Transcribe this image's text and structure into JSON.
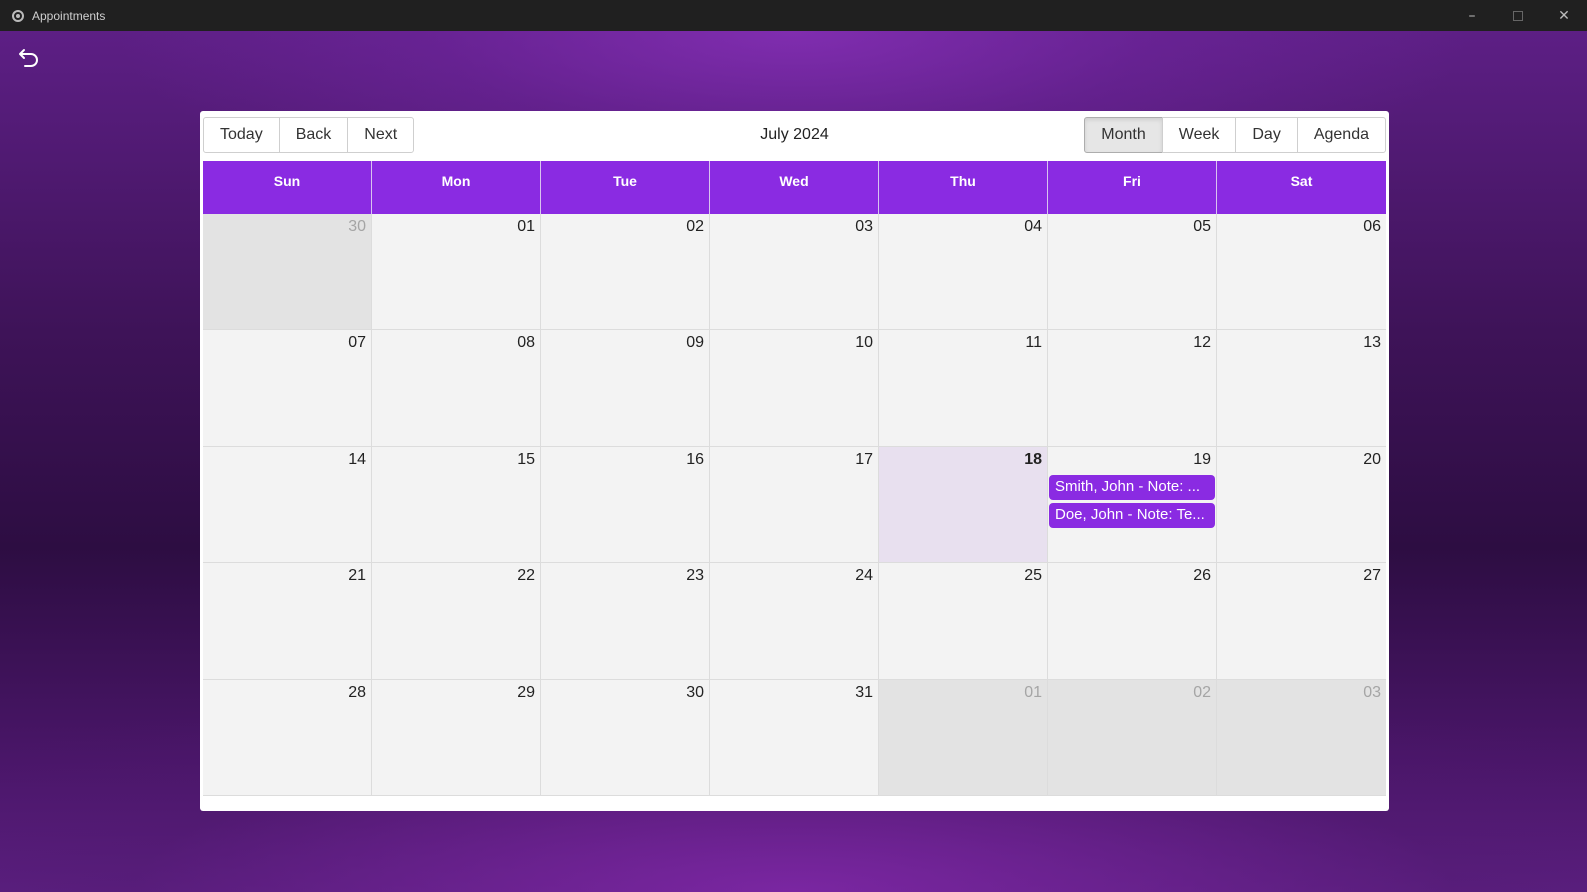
{
  "window": {
    "title": "Appointments"
  },
  "toolbar": {
    "today": "Today",
    "back": "Back",
    "next": "Next",
    "label": "July 2024",
    "views": [
      "Month",
      "Week",
      "Day",
      "Agenda"
    ],
    "active_view": "Month"
  },
  "weekdays": [
    "Sun",
    "Mon",
    "Tue",
    "Wed",
    "Thu",
    "Fri",
    "Sat"
  ],
  "weeks": [
    [
      {
        "day": "30",
        "off": true
      },
      {
        "day": "01"
      },
      {
        "day": "02"
      },
      {
        "day": "03"
      },
      {
        "day": "04"
      },
      {
        "day": "05"
      },
      {
        "day": "06"
      }
    ],
    [
      {
        "day": "07"
      },
      {
        "day": "08"
      },
      {
        "day": "09"
      },
      {
        "day": "10"
      },
      {
        "day": "11"
      },
      {
        "day": "12"
      },
      {
        "day": "13"
      }
    ],
    [
      {
        "day": "14"
      },
      {
        "day": "15"
      },
      {
        "day": "16"
      },
      {
        "day": "17"
      },
      {
        "day": "18",
        "today": true
      },
      {
        "day": "19",
        "events": [
          "Smith, John - Note: ...",
          "Doe, John - Note: Te..."
        ]
      },
      {
        "day": "20"
      }
    ],
    [
      {
        "day": "21"
      },
      {
        "day": "22"
      },
      {
        "day": "23"
      },
      {
        "day": "24"
      },
      {
        "day": "25"
      },
      {
        "day": "26"
      },
      {
        "day": "27"
      }
    ],
    [
      {
        "day": "28"
      },
      {
        "day": "29"
      },
      {
        "day": "30"
      },
      {
        "day": "31"
      },
      {
        "day": "01",
        "off": true
      },
      {
        "day": "02",
        "off": true
      },
      {
        "day": "03",
        "off": true
      }
    ]
  ],
  "colors": {
    "accent": "#8a2be2",
    "cell": "#f3f3f3",
    "off_range": "#e3e3e3",
    "today": "#e8e0ef"
  }
}
